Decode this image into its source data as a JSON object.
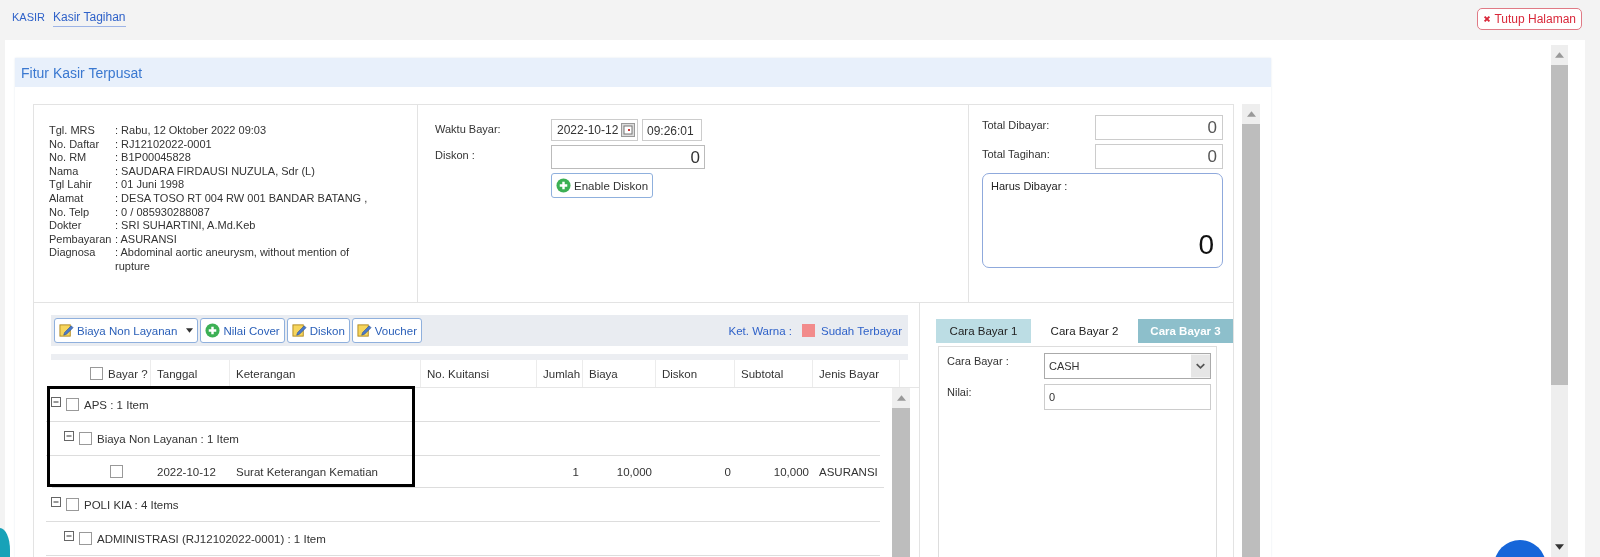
{
  "breadcrumb": [
    {
      "label": "KASIR",
      "selected": false
    },
    {
      "label": "Kasir Tagihan",
      "selected": true
    }
  ],
  "close_button": "Tutup Halaman",
  "panel": {
    "title": "Fitur Kasir Terpusat"
  },
  "patient": [
    {
      "label": "Tgl. MRS",
      "value": ": Rabu, 12 Oktober 2022 09:03"
    },
    {
      "label": "No. Daftar",
      "value": ": RJ12102022-0001"
    },
    {
      "label": "No. RM",
      "value": ": B1P00045828"
    },
    {
      "label": "Nama",
      "value": ": SAUDARA FIRDAUSI NUZULA, Sdr (L)"
    },
    {
      "label": "Tgl Lahir",
      "value": ": 01 Juni 1998"
    },
    {
      "label": "Alamat",
      "value": ": DESA TOSO RT 004 RW 001 BANDAR BATANG ,"
    },
    {
      "label": "No. Telp",
      "value": ": 0 / 085930288087"
    },
    {
      "label": "Dokter",
      "value": ": SRI SUHARTINI, A.Md.Keb"
    },
    {
      "label": "Pembayaran",
      "value": ": ASURANSI"
    },
    {
      "label": "Diagnosa",
      "value": ": Abdominal aortic aneurysm, without mention of rupture"
    }
  ],
  "payment_time": {
    "label": "Waktu Bayar:",
    "date": "2022-10-12",
    "time": "09:26:01"
  },
  "discount": {
    "label": "Diskon :",
    "value": "0",
    "button": "Enable Diskon"
  },
  "totals": {
    "paid": {
      "label": "Total Dibayar:",
      "value": "0"
    },
    "billed": {
      "label": "Total Tagihan:",
      "value": "0"
    },
    "due": {
      "label": "Harus Dibayar :",
      "value": "0"
    }
  },
  "toolbar": [
    {
      "label": "Biaya Non Layanan",
      "kind": "dropdown"
    },
    {
      "label": "Nilai Cover",
      "kind": "add"
    },
    {
      "label": "Diskon",
      "kind": "edit"
    },
    {
      "label": "Voucher",
      "kind": "edit"
    }
  ],
  "legend": {
    "label": "Ket. Warna :",
    "item": "Sudah Terbayar",
    "color": "#f28b8b"
  },
  "table": {
    "select_all": {
      "label": "Bayar ?",
      "checked": false
    },
    "columns": [
      "Tanggal",
      "Keterangan",
      "No. Kuitansi",
      "Jumlah",
      "Biaya",
      "Diskon",
      "Subtotal",
      "Jenis Bayar"
    ],
    "rows": [
      {
        "kind": "group",
        "label": "APS : 1 Item",
        "expanded": true,
        "checked": false,
        "children": [
          {
            "kind": "group",
            "label": "Biaya Non Layanan : 1 Item",
            "expanded": true,
            "checked": false,
            "children": [
              {
                "kind": "item",
                "checked": false,
                "date": "2022-10-12",
                "description": "Surat Keterangan Kematian",
                "quantity": "1",
                "cost": "10,000",
                "discount": "0",
                "subtotal": "10,000",
                "payment_type": "ASURANSI"
              }
            ]
          }
        ]
      },
      {
        "kind": "group",
        "label": "POLI KIA : 4 Items",
        "expanded": true,
        "checked": false,
        "children": [
          {
            "kind": "group",
            "label": "ADMINISTRASI (RJ12102022-0001) : 1 Item",
            "expanded": true,
            "checked": false
          }
        ]
      }
    ]
  },
  "payment_tabs": [
    {
      "label": "Cara Bayar 1",
      "selected": false,
      "disabled": false
    },
    {
      "label": "Cara Bayar 2",
      "selected": true,
      "disabled": false
    },
    {
      "label": "Cara Bayar 3",
      "selected": false,
      "disabled": true
    }
  ],
  "payment_form": {
    "method": {
      "label": "Cara Bayar :",
      "value": "CASH"
    },
    "amount": {
      "label": "Nilai:",
      "value": "0"
    }
  }
}
